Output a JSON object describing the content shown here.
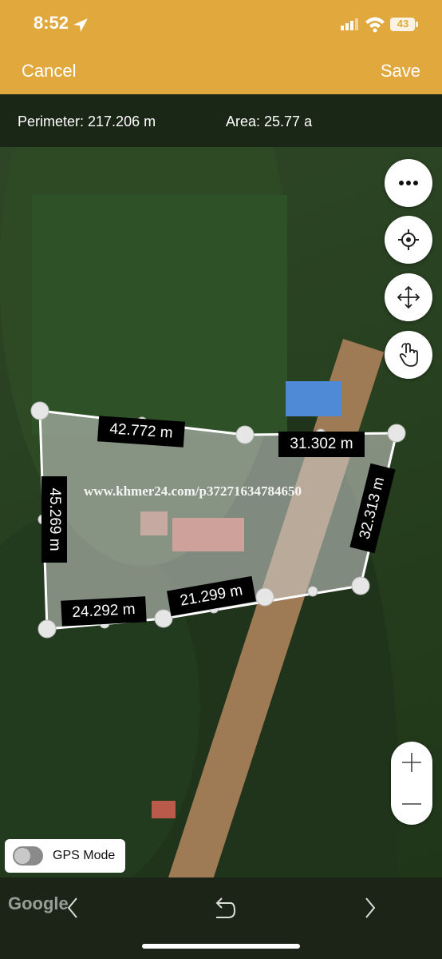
{
  "status_bar": {
    "time": "8:52",
    "battery": "43"
  },
  "nav": {
    "cancel_label": "Cancel",
    "save_label": "Save"
  },
  "info": {
    "perimeter": "Perimeter: 217.206 m",
    "area": "Area: 25.77 a"
  },
  "segments": [
    {
      "name": "segment-label-top-left",
      "text": "42.772 m"
    },
    {
      "name": "segment-label-top-right",
      "text": "31.302 m"
    },
    {
      "name": "segment-label-right",
      "text": "32.313 m"
    },
    {
      "name": "segment-label-bottom-right",
      "text": "21.299 m"
    },
    {
      "name": "segment-label-bottom-left",
      "text": "24.292 m"
    },
    {
      "name": "segment-label-left",
      "text": "45.269 m"
    }
  ],
  "watermark": "www.khmer24.com/p37271634784650",
  "gps": {
    "label": "GPS Mode",
    "enabled": false
  },
  "map_attribution": "Google",
  "icons": {
    "more": "ellipsis-icon",
    "locate": "crosshair-icon",
    "move": "move-arrows-icon",
    "touch": "hand-pointer-icon",
    "zoom_in": "plus-icon",
    "zoom_out": "minus-icon",
    "undo": "undo-icon",
    "prev": "chevron-left-icon",
    "next": "chevron-right-icon"
  },
  "colors": {
    "header": "#e1a93d",
    "polygon_fill": "rgba(210,210,210,0.55)",
    "label_bg": "#000000"
  }
}
